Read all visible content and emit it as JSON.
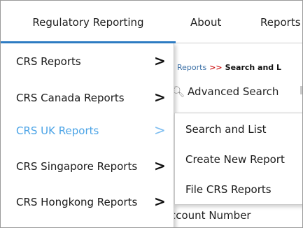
{
  "topnav": {
    "items": [
      "Regulatory Reporting",
      "About",
      "Reports"
    ]
  },
  "breadcrumb": {
    "parent": "Reports",
    "separator": ">>",
    "current": "Search and L"
  },
  "advanced_search": {
    "icon": "search-icon",
    "label": "Advanced Search"
  },
  "account_number_label": "Account Number",
  "dropdown": {
    "items": [
      {
        "label": "CRS Reports",
        "chevron": ">"
      },
      {
        "label": "CRS Canada Reports",
        "chevron": ">"
      },
      {
        "label": "CRS UK Reports",
        "chevron": ">"
      },
      {
        "label": "CRS Singapore Reports",
        "chevron": ">"
      },
      {
        "label": "CRS Hongkong Reports",
        "chevron": ">"
      }
    ],
    "highlighted_index": 2
  },
  "submenu": {
    "items": [
      "Search and List",
      "Create New Report",
      "File CRS Reports"
    ]
  },
  "colors": {
    "accent": "#2f7ec6",
    "hover_text": "#4aa3e6",
    "breadcrumb_separator": "#d02020"
  }
}
